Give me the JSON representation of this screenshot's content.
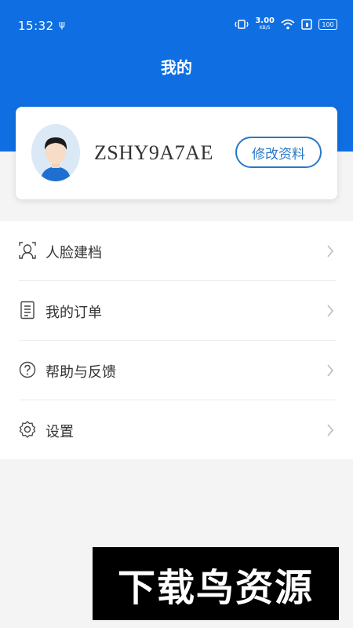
{
  "status_bar": {
    "time": "15:32",
    "usb_icon": "usb-icon",
    "net_speed": "3.00",
    "net_unit": "KB/S",
    "battery": "100"
  },
  "header": {
    "title": "我的"
  },
  "profile": {
    "username": "ZSHY9A7AE",
    "edit_label": "修改资料"
  },
  "menu": {
    "items": [
      {
        "label": "人脸建档",
        "icon": "face-scan-icon"
      },
      {
        "label": "我的订单",
        "icon": "order-list-icon"
      },
      {
        "label": "帮助与反馈",
        "icon": "help-icon"
      },
      {
        "label": "设置",
        "icon": "gear-icon"
      }
    ]
  },
  "watermark": {
    "text": "下载鸟资源"
  },
  "colors": {
    "accent": "#0f6fe2",
    "button": "#2878c8"
  }
}
